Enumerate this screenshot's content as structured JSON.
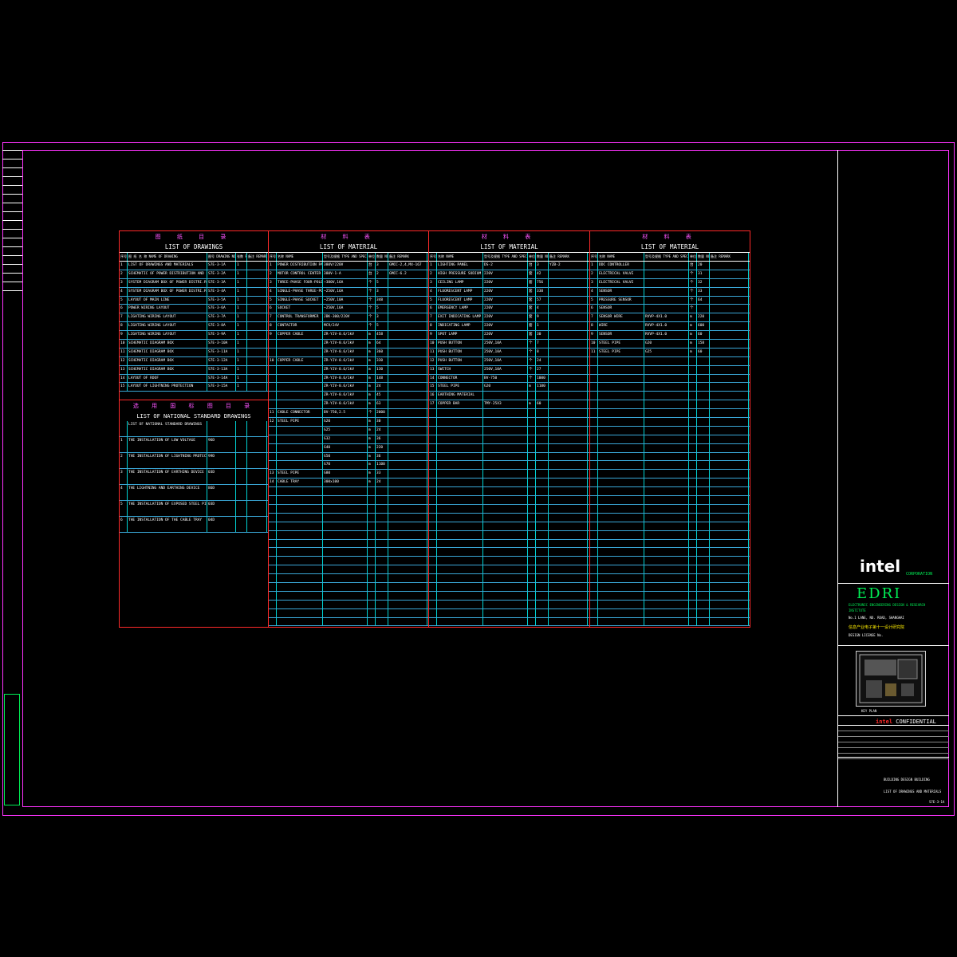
{
  "drawings": {
    "title_cn": "图 纸 目 录",
    "title_en": "LIST OF DRAWINGS",
    "headers": [
      "序号 NO.",
      "图 纸 名 称 NAME OF DRAWING",
      "图号 DRAWING NO",
      "张数 PAGES",
      "备注 REMARK"
    ],
    "rows": [
      [
        "1",
        "LIST OF DRAWINGS AND MATERIALS",
        "S7E-3-1A",
        "1",
        ""
      ],
      [
        "2",
        "SCHEMATIC OF POWER DISTRIBUTION AND LIGHTING",
        "S7E-3-2A",
        "1",
        ""
      ],
      [
        "3",
        "SYSTEM DIAGRAM BOX OF POWER DISTRI.PANEL",
        "S7E-3-3A",
        "1",
        ""
      ],
      [
        "4",
        "SYSTEM DIAGRAM BOX OF POWER DISTRI.PANEL",
        "S7E-3-4A",
        "1",
        ""
      ],
      [
        "5",
        "LAYOUT OF MAIN LINE",
        "S7E-3-5A",
        "1",
        ""
      ],
      [
        "6",
        "POWER WIRING LAYOUT",
        "S7E-3-6A",
        "1",
        ""
      ],
      [
        "7",
        "LIGHTING WIRING LAYOUT",
        "S7E-3-7A",
        "1",
        ""
      ],
      [
        "8",
        "LIGHTING WIRING LAYOUT",
        "S7E-3-8A",
        "1",
        ""
      ],
      [
        "9",
        "LIGHTING WIRING LAYOUT",
        "S7E-3-9A",
        "1",
        ""
      ],
      [
        "10",
        "SCHEMATIC DIAGRAM BOX",
        "S7E-3-10A",
        "1",
        ""
      ],
      [
        "11",
        "SCHEMATIC DIAGRAM BOX",
        "S7E-3-11A",
        "1",
        ""
      ],
      [
        "12",
        "SCHEMATIC DIAGRAM BOX",
        "S7E-3-12A",
        "1",
        ""
      ],
      [
        "13",
        "SCHEMATIC DIAGRAM BOX",
        "S7E-3-13A",
        "1",
        ""
      ],
      [
        "14",
        "LAYOUT OF ROOF",
        "S7E-3-14A",
        "1",
        ""
      ],
      [
        "15",
        "LAYOUT OF LIGHTNING PROTECTION",
        "S7E-3-15A",
        "1",
        ""
      ]
    ],
    "national_title_cn": "选 用 国 标 图 目 录",
    "national_title_en": "LIST OF NATIONAL STANDARD DRAWINGS",
    "national_rows": [
      [
        "",
        "LIST OF NATIONAL STANDARD DRAWINGS",
        "",
        "",
        ""
      ],
      [
        "1",
        "THE INSTALLATION OF LOW VOLTAGE",
        "96D",
        "",
        ""
      ],
      [
        "2",
        "THE INSTALLATION OF LIGHTNING PROTECTION",
        "99D",
        "",
        ""
      ],
      [
        "3",
        "THE INSTALLATION OF EARTHING DEVICE",
        "03D",
        "",
        ""
      ],
      [
        "4",
        "THE LIGHTNING AND EARTHING DEVICE",
        "86D",
        "",
        ""
      ],
      [
        "5",
        "THE INSTALLATION OF EXPOSED STEEL PIPE",
        "03D",
        "",
        ""
      ],
      [
        "6",
        "THE INSTALLATION OF THE CABLE TRAY",
        "04D",
        "",
        ""
      ]
    ]
  },
  "material": {
    "title_cn": "材 料 表",
    "title_en": "LIST OF MATERIAL",
    "headers": [
      "序号 NO.",
      "名称 NAME",
      "型号及规格 TYPE AND SPECIFICATION",
      "单位 UNIT",
      "数量 NUMBER",
      "备注 REMARK"
    ],
    "col1": [
      [
        "1",
        "POWER DISTRIBUTION PANEL",
        "380V/220V",
        "台",
        "3",
        "GMCC-2,4,M4-167"
      ],
      [
        "2",
        "MOTOR CONTROL CENTER",
        "380V-1-A",
        "台",
        "2",
        "GMCC-6.2"
      ],
      [
        "3",
        "THREE-PHASE FOUR-POLE",
        "~380V,16A",
        "个",
        "5",
        ""
      ],
      [
        "4",
        "SINGLE-PHASE THREE-POLE",
        "~250V,16A",
        "个",
        "3",
        ""
      ],
      [
        "5",
        "SINGLE-PHASE SOCKET",
        "~250V,10A",
        "个",
        "348",
        ""
      ],
      [
        "6",
        "SOCKET",
        "~250V,16A",
        "个",
        "5",
        ""
      ],
      [
        "7",
        "CONTROL TRANSFORMER",
        "JBK-300/220V",
        "个",
        "3",
        ""
      ],
      [
        "8",
        "CONTACTOR",
        "MC9/24V",
        "个",
        "5",
        ""
      ],
      [
        "9",
        "COPPER CABLE",
        "ZR-YJV-0.6/1kV",
        "m",
        "458",
        ""
      ],
      [
        "",
        "",
        "ZR-YJV-0.6/1kV",
        "m",
        "64",
        ""
      ],
      [
        "",
        "",
        "ZR-YJV-0.6/1kV",
        "m",
        "360",
        ""
      ],
      [
        "10",
        "COPPER CABLE",
        "ZR-YJV-0.6/1kV",
        "m",
        "330",
        ""
      ],
      [
        "",
        "",
        "ZR-YJV-0.6/1kV",
        "m",
        "130",
        ""
      ],
      [
        "",
        "",
        "ZR-YJV-0.6/1kV",
        "m",
        "148",
        ""
      ],
      [
        "",
        "",
        "ZR-YJV-0.6/1kV",
        "m",
        "24",
        ""
      ],
      [
        "",
        "",
        "ZR-YJV-0.6/1kV",
        "m",
        "45",
        ""
      ],
      [
        "",
        "",
        "ZR-YJV-0.6/1kV",
        "m",
        "63",
        ""
      ],
      [
        "11",
        "CABLE CONNECTOR",
        "BV-750,2.5",
        "个",
        "2000",
        ""
      ],
      [
        "12",
        "STEEL PIPE",
        "G20",
        "m",
        "30",
        ""
      ],
      [
        "",
        "",
        "G25",
        "m",
        "24",
        ""
      ],
      [
        "",
        "",
        "G32",
        "m",
        "36",
        ""
      ],
      [
        "",
        "",
        "G40",
        "m",
        "220",
        ""
      ],
      [
        "",
        "",
        "G50",
        "m",
        "36",
        ""
      ],
      [
        "",
        "",
        "G70",
        "m",
        "1100",
        ""
      ],
      [
        "13",
        "STEEL PIPE",
        "G80",
        "m",
        "33",
        ""
      ],
      [
        "14",
        "CABLE TRAY",
        "300x100",
        "m",
        "24",
        ""
      ]
    ],
    "col2": [
      [
        "1",
        "LIGHTING PANEL",
        "DS-2",
        "台",
        "3",
        "YZB-2"
      ],
      [
        "2",
        "HIGH PRESSURE SODIUM LAMP",
        "220V",
        "套",
        "42",
        ""
      ],
      [
        "3",
        "CEILING LAMP",
        "220V",
        "套",
        "756",
        ""
      ],
      [
        "4",
        "FLUORESCENT LAMP",
        "220V",
        "套",
        "338",
        ""
      ],
      [
        "5",
        "FLUORESCENT LAMP",
        "220V",
        "套",
        "57",
        ""
      ],
      [
        "6",
        "EMERGENCY LAMP",
        "220V",
        "套",
        "4",
        ""
      ],
      [
        "7",
        "EXIT INDICATING LAMP",
        "220V",
        "套",
        "9",
        ""
      ],
      [
        "8",
        "INDICATING LAMP",
        "220V",
        "套",
        "1",
        ""
      ],
      [
        "9",
        "SPOT LAMP",
        "220V",
        "套",
        "30",
        ""
      ],
      [
        "10",
        "PUSH BUTTON",
        "250V,10A",
        "个",
        "7",
        ""
      ],
      [
        "11",
        "PUSH BUTTON",
        "250V,10A",
        "个",
        "8",
        ""
      ],
      [
        "12",
        "PUSH BUTTON",
        "250V,10A",
        "个",
        "24",
        ""
      ],
      [
        "13",
        "SWITCH",
        "250V,10A",
        "个",
        "27",
        ""
      ],
      [
        "14",
        "CONNECTOR",
        "BV-750",
        "个",
        "1000",
        ""
      ],
      [
        "15",
        "STEEL PIPE",
        "G20",
        "m",
        "1100",
        ""
      ],
      [
        "16",
        "EARTHING MATERIAL",
        "",
        "",
        "",
        ""
      ],
      [
        "17",
        "COPPER BAR",
        "TMY-25X3",
        "m",
        "60",
        ""
      ]
    ],
    "col3": [
      [
        "1",
        "DDC CONTROLLER",
        "",
        "台",
        "20",
        ""
      ],
      [
        "2",
        "ELECTRICAL VALVE",
        "",
        "个",
        "31",
        ""
      ],
      [
        "3",
        "ELECTRICAL VALVE",
        "",
        "个",
        "32",
        ""
      ],
      [
        "4",
        "SENSOR",
        "",
        "个",
        "33",
        ""
      ],
      [
        "5",
        "PRESSURE SENSOR",
        "",
        "个",
        "64",
        ""
      ],
      [
        "6",
        "SENSOR",
        "",
        "个",
        "",
        ""
      ],
      [
        "7",
        "SENSOR WIRE",
        "RVVP-4X1.0",
        "m",
        "220",
        ""
      ],
      [
        "8",
        "WIRE",
        "RVVP-4X1.0",
        "m",
        "600",
        ""
      ],
      [
        "9",
        "SENSOR",
        "RVVP-4X1.0",
        "m",
        "60",
        ""
      ],
      [
        "10",
        "STEEL PIPE",
        "G20",
        "m",
        "158",
        ""
      ],
      [
        "11",
        "STEEL PIPE",
        "G25",
        "m",
        "60",
        ""
      ]
    ]
  },
  "title_block": {
    "logo": "intel",
    "corporation": "CORPORATION",
    "edri": "EDRI",
    "edri_line1": "ELECTRONIC ENGINEERING DESIGN & RESEARCH",
    "edri_line2": "INSTITUTE",
    "address": "No.1 LANE, NO. ROAD, SHANGHAI",
    "cn_name": "信息产业电子第十一设计研究院",
    "cert": "DESIGN LICENSE No. ",
    "key_plan": "KEY PLAN",
    "confidential_brand": "intel",
    "confidential": "CONFIDENTIAL",
    "project": "BUILDING DESIGN BUILDING",
    "drawing_title": "LIST OF DRAWINGS AND MATERIALS",
    "drawing_no": "S7E-3-1A"
  },
  "colors": {
    "frame": "#ff33ff",
    "table_border": "#ff2a2a",
    "grid": "#00d4d4",
    "accent_green": "#00ee55"
  }
}
